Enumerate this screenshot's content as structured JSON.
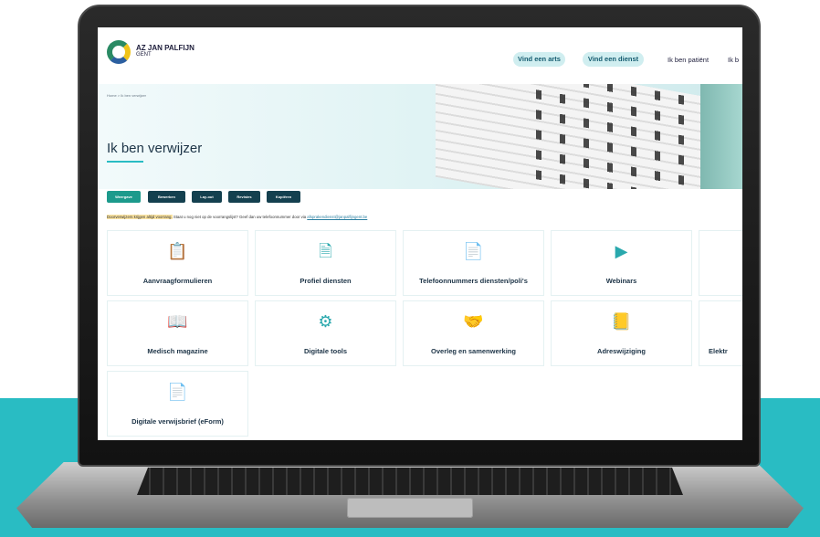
{
  "header": {
    "logo_name": "AZ JAN PALFIJN",
    "logo_city": "GENT",
    "pill_find_doctor": "Vind een arts",
    "pill_find_service": "Vind een dienst",
    "nav_patient": "Ik ben patiënt",
    "nav_cut": "Ik b"
  },
  "hero": {
    "breadcrumb": "Home > Ik ben verwijzer",
    "title": "Ik ben verwijzer"
  },
  "toolbar": {
    "view": "Weergave",
    "edit": "Bewerken",
    "layout": "Lay-out",
    "revisions": "Revisies",
    "copy": "Kopiëren"
  },
  "notice": {
    "highlight": "Doorverwijzers krijgen altijd voorrang.",
    "text": "Staat u nog niet op de voorrangslijst? Geef dan uw telefoonnummer door via",
    "link": "afsprakendienst@janpalfijngent.be"
  },
  "cards": [
    {
      "label": "Aanvraagformulieren",
      "icon": "clipboard-icon"
    },
    {
      "label": "Profiel diensten",
      "icon": "profile-card-icon"
    },
    {
      "label": "Telefoonnummers diensten/poli's",
      "icon": "phone-document-icon"
    },
    {
      "label": "Webinars",
      "icon": "monitor-play-icon"
    },
    {
      "label": "",
      "icon": ""
    },
    {
      "label": "Medisch magazine",
      "icon": "magazine-icon"
    },
    {
      "label": "Digitale tools",
      "icon": "gear-icon"
    },
    {
      "label": "Overleg en samenwerking",
      "icon": "handshake-icon"
    },
    {
      "label": "Adreswijziging",
      "icon": "address-book-icon"
    },
    {
      "label": "Elektr",
      "icon": ""
    },
    {
      "label": "Digitale verwijsbrief (eForm)",
      "icon": "eform-document-icon"
    }
  ],
  "colors": {
    "teal": "#29bcc3",
    "active_button": "#1c9a8c",
    "dark_button": "#14404f"
  }
}
